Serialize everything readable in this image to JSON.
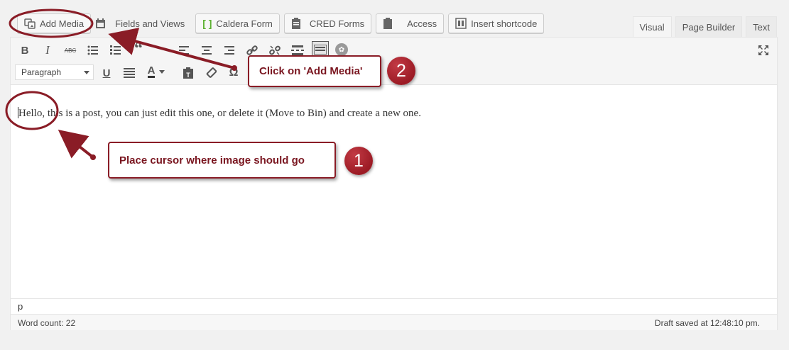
{
  "media_buttons": {
    "add_media": "Add Media",
    "fields_views": "Fields and Views",
    "caldera": "Caldera Form",
    "cred": "CRED Forms",
    "access": "Access",
    "shortcode": "Insert shortcode"
  },
  "tabs": {
    "visual": "Visual",
    "page_builder": "Page Builder",
    "text": "Text",
    "active": "Visual"
  },
  "toolbar": {
    "format_select": "Paragraph",
    "icons": [
      "bold-icon",
      "italic-icon",
      "strikethrough-icon",
      "bullet-list-icon",
      "numbered-list-icon",
      "blockquote-icon",
      "align-left-icon",
      "align-center-icon",
      "align-right-icon",
      "link-icon",
      "unlink-icon",
      "read-more-icon",
      "toolbar-toggle-icon",
      "plugin-icon",
      "fullscreen-icon",
      "underline-icon",
      "justify-icon",
      "text-color-icon",
      "paste-text-icon",
      "clear-format-icon",
      "special-char-icon"
    ]
  },
  "content": {
    "text": "Hello, this is a post, you can just edit this one, or delete it (Move to Bin) and create a new one."
  },
  "path": "p",
  "status": {
    "word_count": "Word count: 22",
    "draft_saved": "Draft saved at 12:48:10 pm."
  },
  "annotations": {
    "step1_text": "Place cursor where image should go",
    "step1_number": "1",
    "step2_text": "Click on 'Add Media'",
    "step2_number": "2",
    "accent_color": "#8a1c26"
  }
}
